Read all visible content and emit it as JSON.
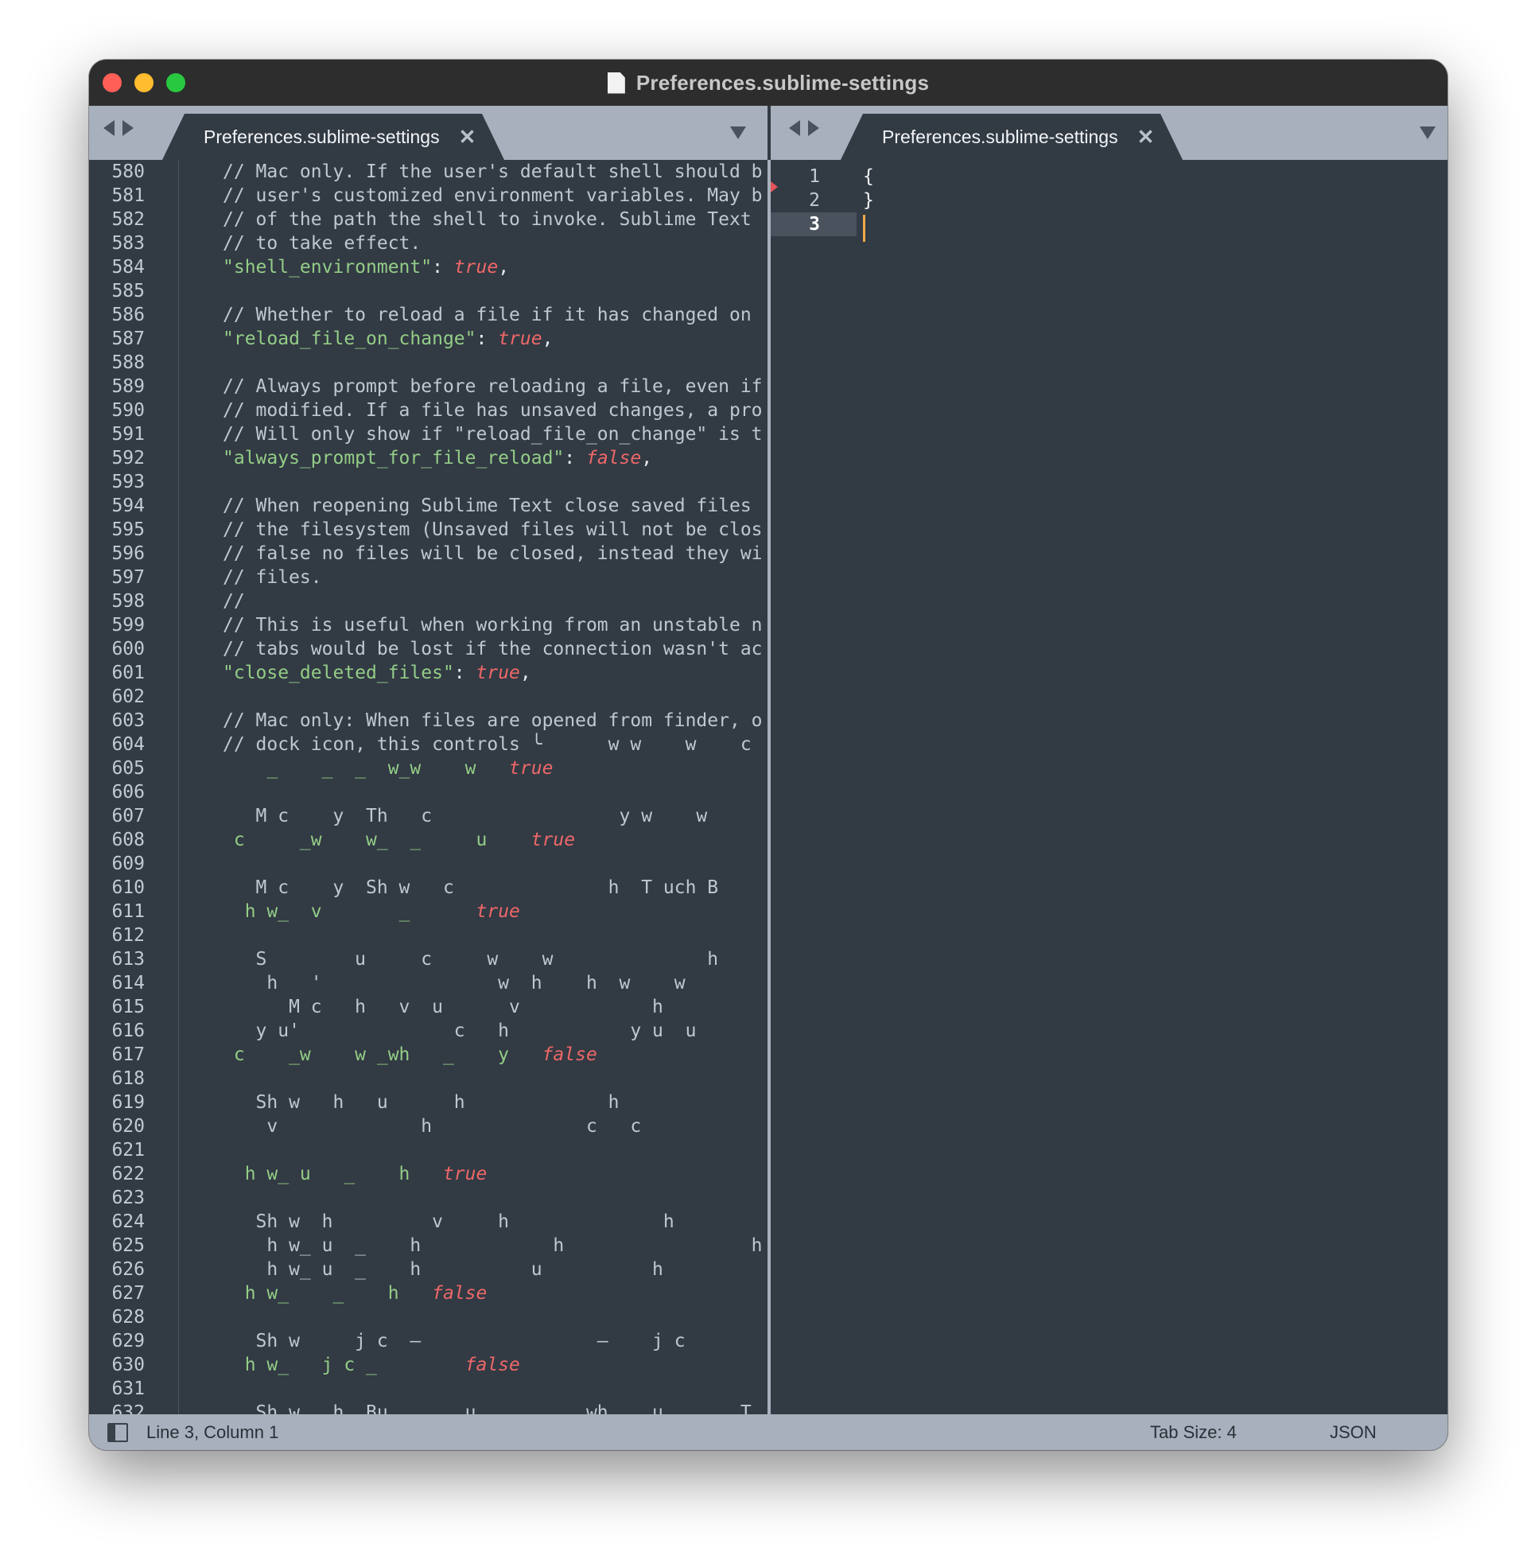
{
  "window": {
    "title": "Preferences.sublime-settings"
  },
  "left_pane": {
    "tab_label": "Preferences.sublime-settings",
    "lines": [
      {
        "n": "580",
        "parts": [
          [
            "c",
            "// Mac only. If the user's default shell should b"
          ]
        ]
      },
      {
        "n": "581",
        "parts": [
          [
            "c",
            "// user's customized environment variables. May b"
          ]
        ]
      },
      {
        "n": "582",
        "parts": [
          [
            "c",
            "// of the path the shell to invoke. Sublime Text "
          ]
        ]
      },
      {
        "n": "583",
        "parts": [
          [
            "c",
            "// to take effect."
          ]
        ]
      },
      {
        "n": "584",
        "parts": [
          [
            "s",
            "\"shell_environment\""
          ],
          [
            "p",
            ": "
          ],
          [
            "k",
            "true"
          ],
          [
            "p",
            ","
          ]
        ]
      },
      {
        "n": "585",
        "parts": []
      },
      {
        "n": "586",
        "parts": [
          [
            "c",
            "// Whether to reload a file if it has changed on "
          ]
        ]
      },
      {
        "n": "587",
        "parts": [
          [
            "s",
            "\"reload_file_on_change\""
          ],
          [
            "p",
            ": "
          ],
          [
            "k",
            "true"
          ],
          [
            "p",
            ","
          ]
        ]
      },
      {
        "n": "588",
        "parts": []
      },
      {
        "n": "589",
        "parts": [
          [
            "c",
            "// Always prompt before reloading a file, even if"
          ]
        ]
      },
      {
        "n": "590",
        "parts": [
          [
            "c",
            "// modified. If a file has unsaved changes, a pro"
          ]
        ]
      },
      {
        "n": "591",
        "parts": [
          [
            "c",
            "// Will only show if \"reload_file_on_change\" is t"
          ]
        ]
      },
      {
        "n": "592",
        "parts": [
          [
            "s",
            "\"always_prompt_for_file_reload\""
          ],
          [
            "p",
            ": "
          ],
          [
            "k",
            "false"
          ],
          [
            "p",
            ","
          ]
        ]
      },
      {
        "n": "593",
        "parts": []
      },
      {
        "n": "594",
        "parts": [
          [
            "c",
            "// When reopening Sublime Text close saved files "
          ]
        ]
      },
      {
        "n": "595",
        "parts": [
          [
            "c",
            "// the filesystem (Unsaved files will not be clos"
          ]
        ]
      },
      {
        "n": "596",
        "parts": [
          [
            "c",
            "// false no files will be closed, instead they wi"
          ]
        ]
      },
      {
        "n": "597",
        "parts": [
          [
            "c",
            "// files."
          ]
        ]
      },
      {
        "n": "598",
        "parts": [
          [
            "c",
            "//"
          ]
        ]
      },
      {
        "n": "599",
        "parts": [
          [
            "c",
            "// This is useful when working from an unstable n"
          ]
        ]
      },
      {
        "n": "600",
        "parts": [
          [
            "c",
            "// tabs would be lost if the connection wasn't ac"
          ]
        ]
      },
      {
        "n": "601",
        "parts": [
          [
            "s",
            "\"close_deleted_files\""
          ],
          [
            "p",
            ": "
          ],
          [
            "k",
            "true"
          ],
          [
            "p",
            ","
          ]
        ]
      },
      {
        "n": "602",
        "parts": []
      },
      {
        "n": "603",
        "parts": [
          [
            "c",
            "// Mac only: When files are opened from finder, o"
          ]
        ]
      },
      {
        "n": "604",
        "parts": [
          [
            "c",
            "// dock icon, this controls ╰      w w    w    c"
          ]
        ]
      },
      {
        "n": "605",
        "parts": [
          [
            "s",
            "    _    _  _  w_w    w   "
          ],
          [
            "k",
            "true"
          ]
        ]
      },
      {
        "n": "606",
        "parts": []
      },
      {
        "n": "607",
        "parts": [
          [
            "c",
            "   M c    y  Th   c                 y w    w"
          ]
        ]
      },
      {
        "n": "608",
        "parts": [
          [
            "s",
            " c     _w    w_  _     u    "
          ],
          [
            "k",
            "true"
          ]
        ]
      },
      {
        "n": "609",
        "parts": []
      },
      {
        "n": "610",
        "parts": [
          [
            "c",
            "   M c    y  Sh w   c              h  T uch B"
          ]
        ]
      },
      {
        "n": "611",
        "parts": [
          [
            "s",
            "  h w_  v       _      "
          ],
          [
            "k",
            "true"
          ]
        ]
      },
      {
        "n": "612",
        "parts": []
      },
      {
        "n": "613",
        "parts": [
          [
            "c",
            "   S        u     c     w    w              h"
          ]
        ]
      },
      {
        "n": "614",
        "parts": [
          [
            "c",
            "    h   '                w  h    h  w    w"
          ]
        ]
      },
      {
        "n": "615",
        "parts": [
          [
            "c",
            "      M c   h   v  u      v            h"
          ]
        ]
      },
      {
        "n": "616",
        "parts": [
          [
            "c",
            "   y u'              c   h           y u  u"
          ]
        ]
      },
      {
        "n": "617",
        "parts": [
          [
            "s",
            " c    _w    w _wh   _    y   "
          ],
          [
            "k",
            "false"
          ]
        ]
      },
      {
        "n": "618",
        "parts": []
      },
      {
        "n": "619",
        "parts": [
          [
            "c",
            "   Sh w   h   u      h             h"
          ]
        ]
      },
      {
        "n": "620",
        "parts": [
          [
            "c",
            "    v             h              c   c"
          ]
        ]
      },
      {
        "n": "621",
        "parts": []
      },
      {
        "n": "622",
        "parts": [
          [
            "s",
            "  h w_ u   _    h   "
          ],
          [
            "k",
            "true"
          ]
        ]
      },
      {
        "n": "623",
        "parts": []
      },
      {
        "n": "624",
        "parts": [
          [
            "c",
            "   Sh w  h         v     h              h"
          ]
        ]
      },
      {
        "n": "625",
        "parts": [
          [
            "c",
            "    h w_ u  _    h            h                 h"
          ]
        ]
      },
      {
        "n": "626",
        "parts": [
          [
            "c",
            "    h w_ u  _    h          u          h"
          ]
        ]
      },
      {
        "n": "627",
        "parts": [
          [
            "s",
            "  h w_    _    h   "
          ],
          [
            "k",
            "false"
          ]
        ]
      },
      {
        "n": "628",
        "parts": []
      },
      {
        "n": "629",
        "parts": [
          [
            "c",
            "   Sh w     j c  –                –    j c"
          ]
        ]
      },
      {
        "n": "630",
        "parts": [
          [
            "s",
            "  h w_   j c _        "
          ],
          [
            "k",
            "false"
          ]
        ]
      },
      {
        "n": "631",
        "parts": []
      },
      {
        "n": "632",
        "parts": [
          [
            "c",
            "   Sh w   h  Bu       u          wh    u       T"
          ]
        ]
      }
    ]
  },
  "right_pane": {
    "tab_label": "Preferences.sublime-settings",
    "lines": [
      {
        "n": "1",
        "text": "{"
      },
      {
        "n": "2",
        "text": "}"
      },
      {
        "n": "3",
        "text": ""
      }
    ]
  },
  "status_bar": {
    "position": "Line 3, Column 1",
    "tab_size": "Tab Size: 4",
    "syntax": "JSON"
  },
  "icons": {
    "close": "close-icon",
    "nav": [
      "arrow-left-icon",
      "arrow-right-icon"
    ],
    "dropdown": "chevron-down-icon",
    "file": "document-icon",
    "sidebar": "sidebar-toggle-icon"
  },
  "colors": {
    "editor_bg": "#323a44",
    "chrome": "#a7b0bc",
    "titlebar": "#2d2d2d",
    "string": "#93cd86",
    "keyword": "#ee6868",
    "comment": "#c0c7d1",
    "caret": "#f0a848"
  }
}
